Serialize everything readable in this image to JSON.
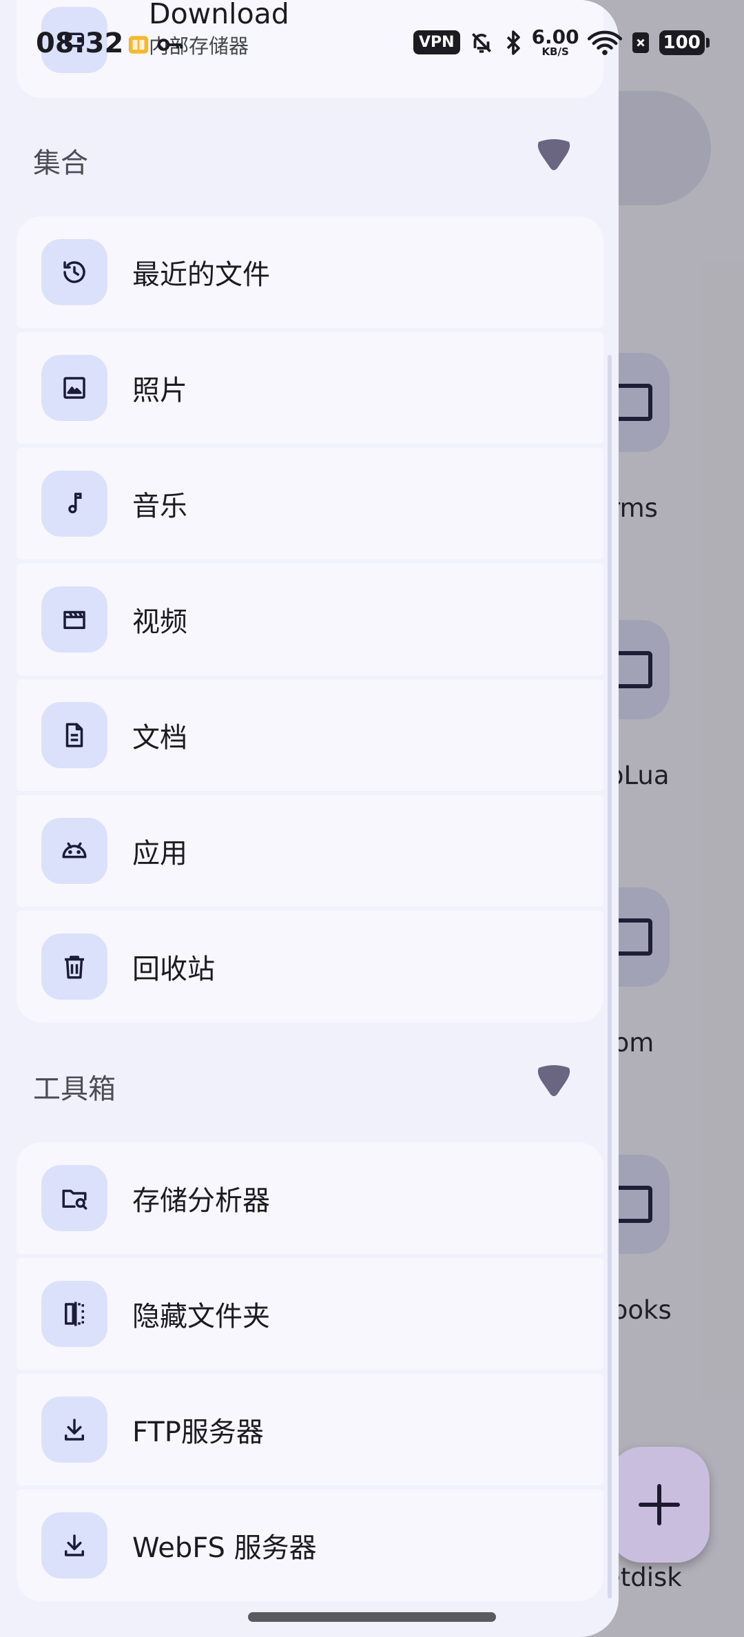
{
  "status_bar": {
    "time": "08:32",
    "vpn": "VPN",
    "speed_value": "6.00",
    "speed_unit": "KB/S",
    "battery": "100"
  },
  "top_card": {
    "title": "Download",
    "subtitle": "内部存储器"
  },
  "collections": {
    "title": "集合",
    "items": [
      {
        "label": "最近的文件",
        "icon": "history-icon"
      },
      {
        "label": "照片",
        "icon": "image-icon"
      },
      {
        "label": "音乐",
        "icon": "music-note-icon"
      },
      {
        "label": "视频",
        "icon": "movie-icon"
      },
      {
        "label": "文档",
        "icon": "document-icon"
      },
      {
        "label": "应用",
        "icon": "android-icon"
      },
      {
        "label": "回收站",
        "icon": "trash-icon"
      }
    ]
  },
  "toolbox": {
    "title": "工具箱",
    "items": [
      {
        "label": "存储分析器",
        "icon": "folder-search-icon"
      },
      {
        "label": "隐藏文件夹",
        "icon": "hidden-folder-icon"
      },
      {
        "label": "FTP服务器",
        "icon": "download-icon"
      },
      {
        "label": "WebFS 服务器",
        "icon": "download-icon"
      }
    ]
  },
  "background": {
    "labels": [
      "rms",
      "roLua",
      "om",
      "books",
      "Netdisk"
    ]
  },
  "colors": {
    "accent_icon_bg": "#dbe1fa",
    "chevron": "#6a6580",
    "drawer_bg": "#f1f1fc"
  }
}
